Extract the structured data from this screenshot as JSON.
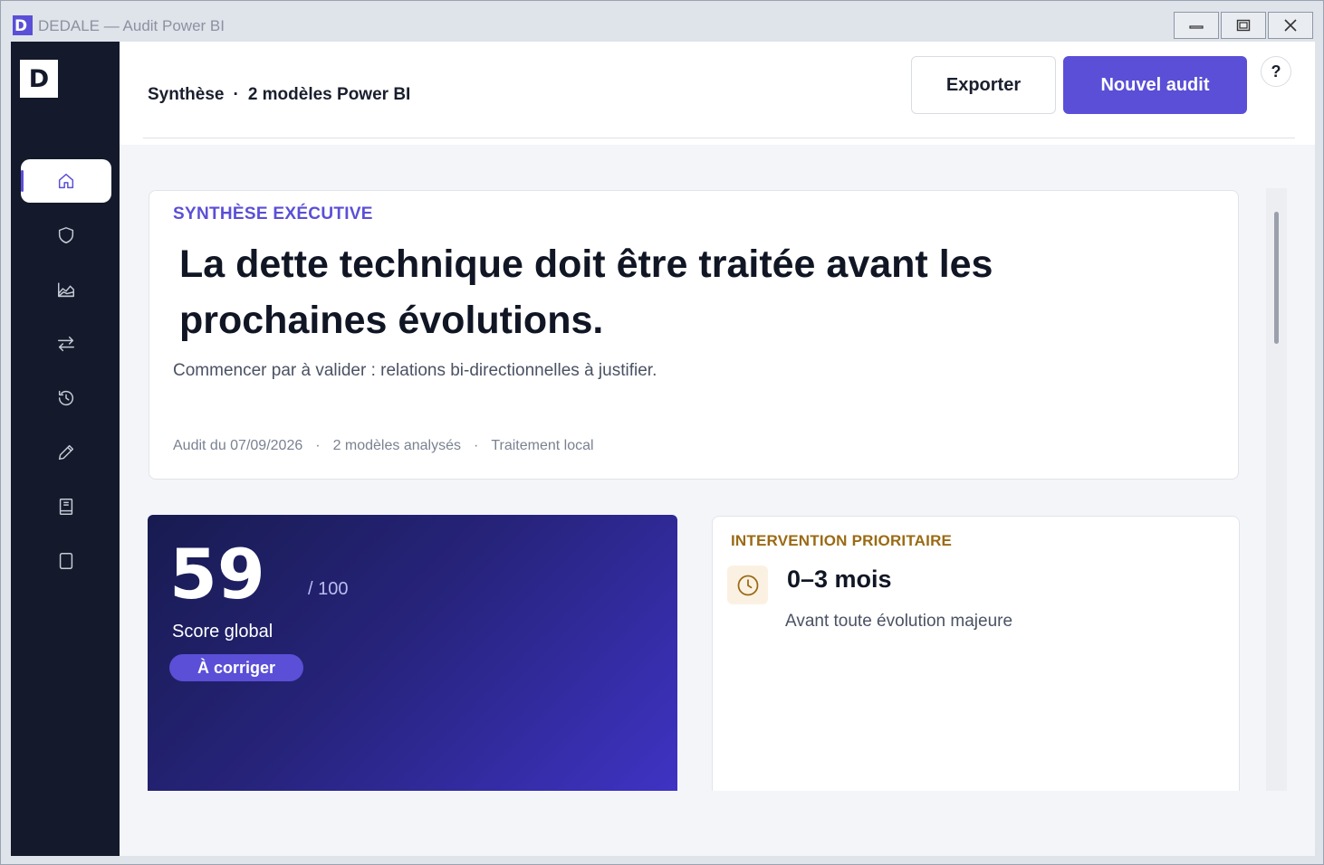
{
  "window": {
    "icon_letter": "D",
    "title": "DEDALE — Audit Power BI"
  },
  "sidebar": {
    "logo_letter": "D",
    "items": [
      {
        "icon": "home-icon",
        "active": true
      },
      {
        "icon": "shield-icon",
        "active": false
      },
      {
        "icon": "area-chart-icon",
        "active": false
      },
      {
        "icon": "swap-arrows-icon",
        "active": false
      },
      {
        "icon": "history-icon",
        "active": false
      },
      {
        "icon": "pencil-icon",
        "active": false
      },
      {
        "icon": "book-icon",
        "active": false
      },
      {
        "icon": "tablet-icon",
        "active": false
      }
    ]
  },
  "header": {
    "breadcrumb": {
      "section": "Synthèse",
      "separator": "·",
      "context": "2 modèles Power BI"
    },
    "export_label": "Exporter",
    "new_audit_label": "Nouvel audit",
    "help_label": "?"
  },
  "executive": {
    "kicker": "SYNTHÈSE EXÉCUTIVE",
    "headline": "La dette technique doit être traitée avant les prochaines évolutions.",
    "subtitle": "Commencer par à valider : relations bi-directionnelles à justifier.",
    "meta": {
      "audit_date": "Audit du 07/09/2026",
      "sep1": "·",
      "models": "2 modèles analysés",
      "sep2": "·",
      "processing": "Traitement local"
    }
  },
  "score": {
    "value": "59",
    "max": "/ 100",
    "label": "Score global",
    "badge": "À corriger"
  },
  "intervention": {
    "kicker": "INTERVENTION PRIORITAIRE",
    "icon": "clock-icon",
    "title": "0–3 mois",
    "subtitle": "Avant toute évolution majeure"
  },
  "colors": {
    "accent": "#5a4fd6",
    "sidebar_bg": "#141a2b",
    "warning_text": "#9a6a14"
  }
}
